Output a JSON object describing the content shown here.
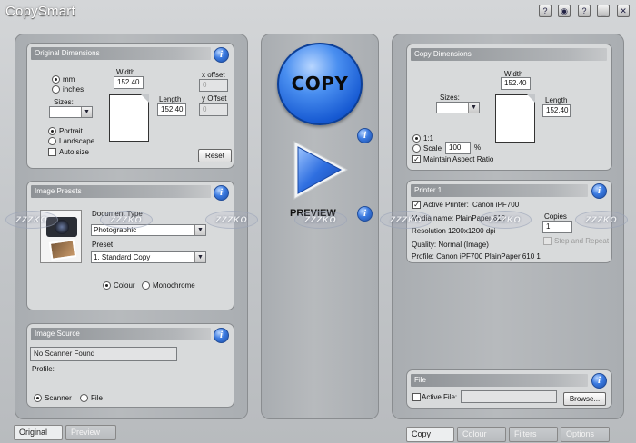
{
  "app": {
    "title": "CopySmart"
  },
  "titlebar": {
    "icons": [
      "help-icon",
      "globe-icon",
      "question-icon",
      "minimize-icon",
      "close-icon"
    ]
  },
  "original_dimensions": {
    "header": "Original Dimensions",
    "unit_mm": "mm",
    "unit_inches": "inches",
    "sizes_label": "Sizes:",
    "width_label": "Width",
    "width_value": "152.40",
    "length_label": "Length",
    "length_value": "152.40",
    "x_offset_label": "x offset",
    "x_offset_value": "0",
    "y_offset_label": "y Offset",
    "y_offset_value": "0",
    "portrait": "Portrait",
    "landscape": "Landscape",
    "auto_size": "Auto size",
    "reset": "Reset"
  },
  "image_presets": {
    "header": "Image Presets",
    "doc_type_label": "Document Type",
    "doc_type_value": "Photographic",
    "preset_label": "Preset",
    "preset_value": "1. Standard Copy",
    "colour": "Colour",
    "monochrome": "Monochrome"
  },
  "image_source": {
    "header": "Image Source",
    "scanner_status": "No Scanner Found",
    "profile_label": "Profile:",
    "scanner": "Scanner",
    "file": "File"
  },
  "center": {
    "copy_label": "COPY",
    "preview_label": "PREVIEW"
  },
  "copy_dimensions": {
    "header": "Copy Dimensions",
    "width_label": "Width",
    "width_value": "152.40",
    "length_label": "Length",
    "length_value": "152.40",
    "sizes_label": "Sizes:",
    "ratio_1_1": "1:1",
    "scale_label": "Scale",
    "scale_value": "100",
    "percent": "%",
    "maintain_aspect": "Maintain Aspect Ratio"
  },
  "printer": {
    "header": "Printer 1",
    "active_printer_label": "Active Printer:",
    "active_printer_value": "Canon iPF700",
    "media_name": "Media name: PlainPaper 610",
    "resolution": "Resolution 1200x1200 dpi",
    "quality": "Quality: Normal (Image)",
    "profile": "Profile: Canon iPF700 PlainPaper 610 1",
    "copies_label": "Copies",
    "copies_value": "1",
    "step_repeat": "Step and Repeat"
  },
  "file_panel": {
    "header": "File",
    "active_file": "Active File:",
    "browse": "Browse..."
  },
  "left_tabs": [
    "Original",
    "Preview"
  ],
  "right_tabs": [
    "Copy",
    "Colour",
    "Filters",
    "Options"
  ],
  "watermark": "ZZZKO"
}
